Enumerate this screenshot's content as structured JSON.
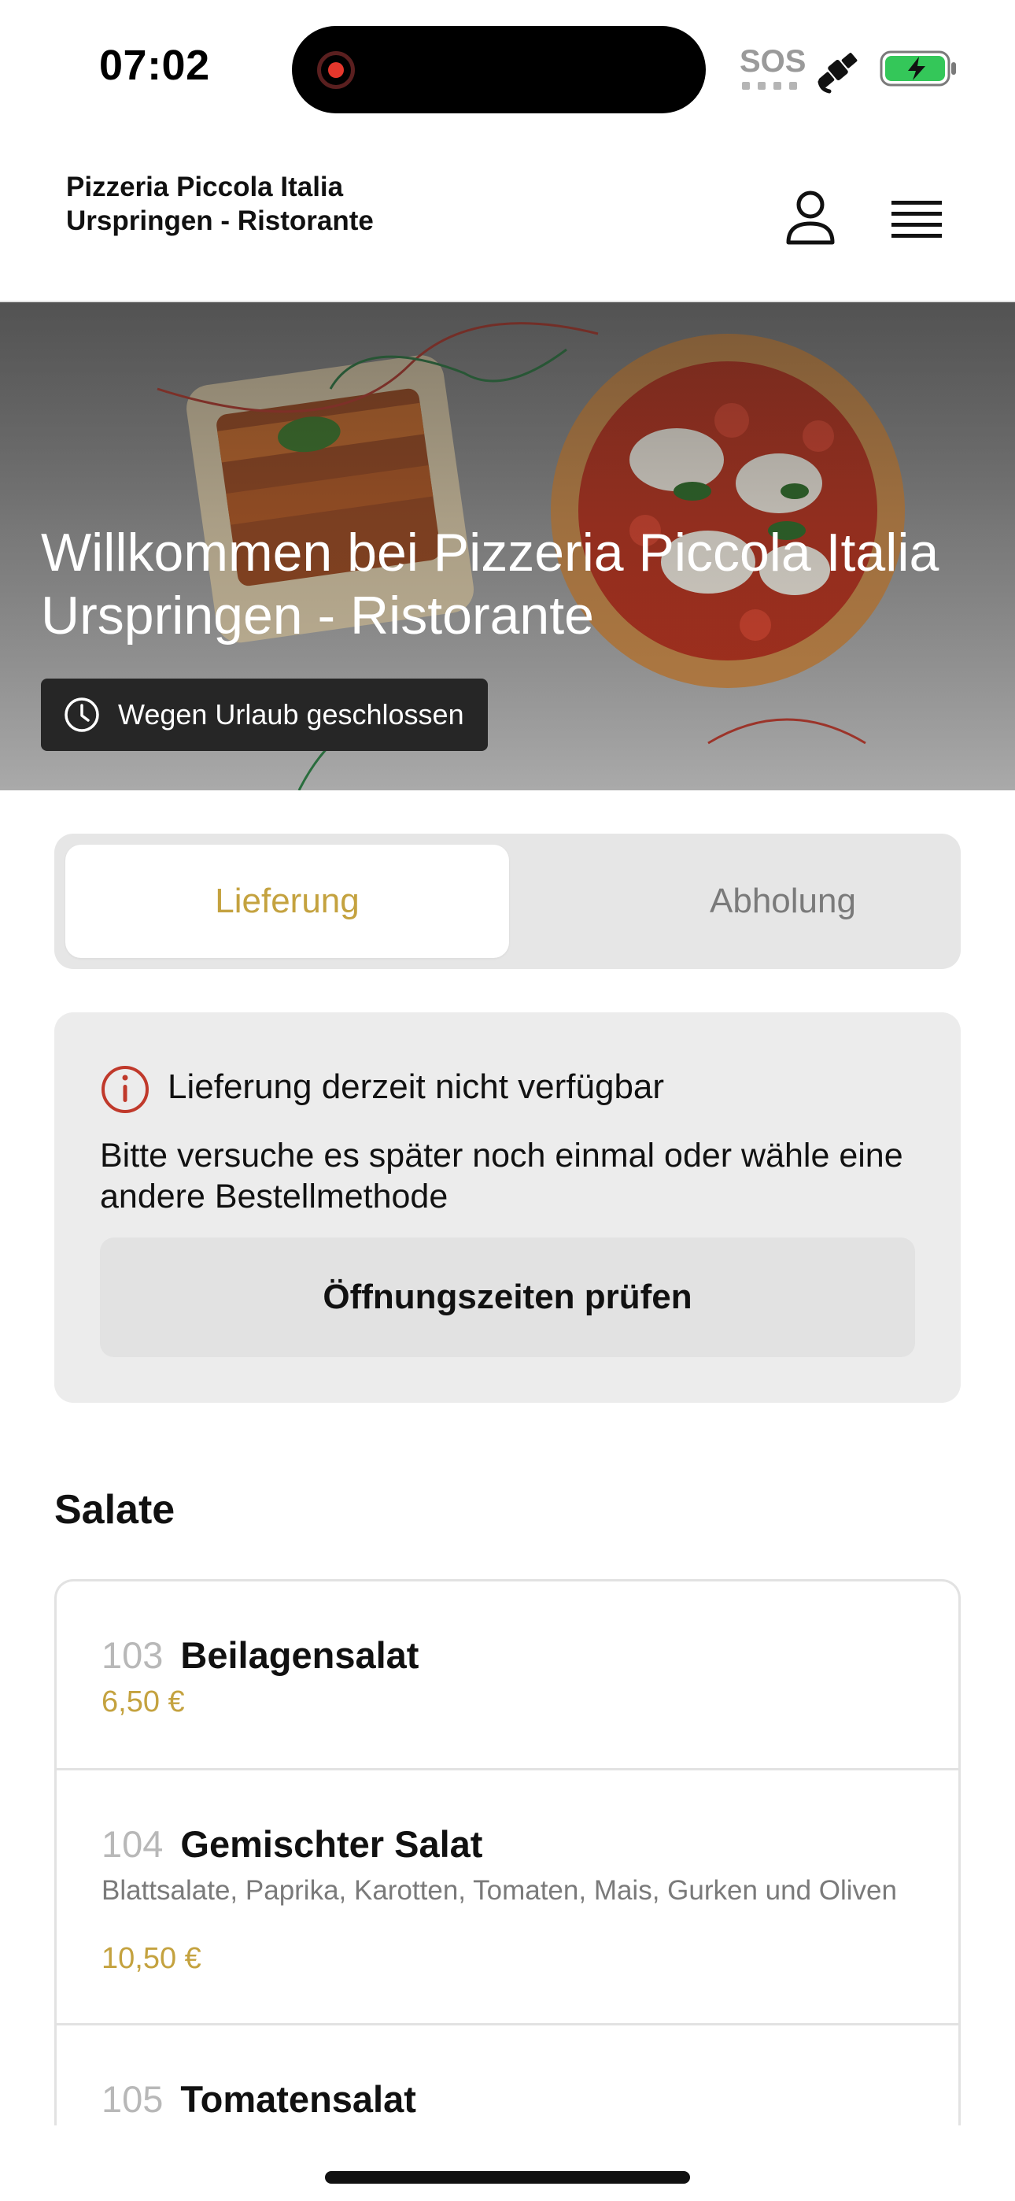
{
  "status_bar": {
    "time": "07:02",
    "sos": "SOS",
    "icons": [
      "recording-icon",
      "satellite-icon",
      "battery-charging-icon"
    ],
    "battery_color": "#34c759"
  },
  "header": {
    "title": "Pizzeria Piccola Italia Urspringen - Ristorante",
    "icons": [
      "user-icon",
      "hamburger-menu-icon"
    ]
  },
  "hero": {
    "title": "Willkommen bei Pizzeria Piccola Italia Urspringen - Ristorante",
    "status_text": "Wegen Urlaub geschlossen",
    "status_icon": "clock-icon"
  },
  "order_tabs": {
    "items": [
      {
        "label": "Lieferung",
        "active": true
      },
      {
        "label": "Abholung",
        "active": false
      }
    ],
    "accent_color": "#c4a23f"
  },
  "notice": {
    "icon": "alert-circle-icon",
    "icon_color": "#c0392b",
    "title": "Lieferung derzeit nicht verfügbar",
    "body": "Bitte versuche es später noch einmal oder wähle eine andere Bestellmethode",
    "button_label": "Öffnungszeiten prüfen"
  },
  "menu": {
    "section_title": "Salate",
    "items": [
      {
        "number": "103",
        "name": "Beilagensalat",
        "description": "",
        "price": "6,50 €"
      },
      {
        "number": "104",
        "name": "Gemischter Salat",
        "description": "Blattsalate, Paprika, Karotten, Tomaten, Mais, Gurken und Oliven",
        "price": "10,50 €"
      },
      {
        "number": "105",
        "name": "Tomatensalat",
        "description": "",
        "price": ""
      }
    ]
  }
}
